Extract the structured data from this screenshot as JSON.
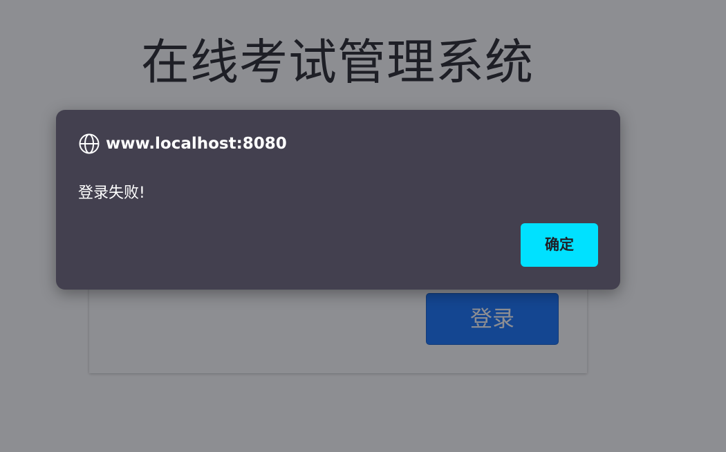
{
  "page": {
    "title": "在线考试管理系统"
  },
  "login_form": {
    "submit_label": "登录"
  },
  "alert_dialog": {
    "origin": "www.localhost:8080",
    "message": "登录失败!",
    "ok_label": "确定"
  },
  "colors": {
    "dialog_background": "#43404f",
    "ok_button": "#00e1ff",
    "login_button": "#0d6efd",
    "overlay": "rgba(28,30,38,0.5)"
  },
  "icons": {
    "dialog_origin_icon": "globe-icon"
  }
}
